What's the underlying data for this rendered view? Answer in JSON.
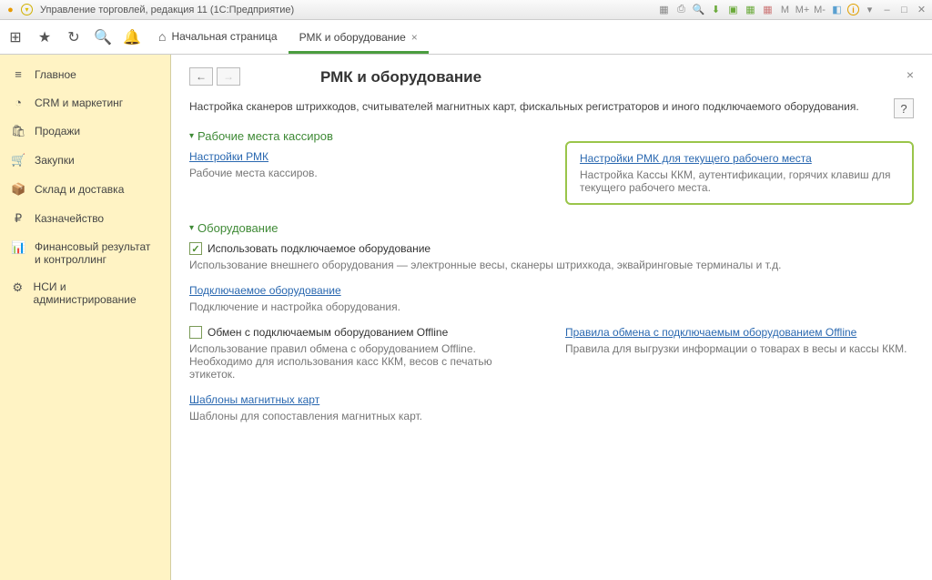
{
  "titlebar": {
    "title": "Управление торговлей, редакция 11  (1С:Предприятие)",
    "m_icons": [
      "M",
      "M+",
      "M-"
    ]
  },
  "tabs": {
    "home": "Начальная страница",
    "active": "РМК и оборудование"
  },
  "sidebar": {
    "items": [
      {
        "icon": "≡",
        "label": "Главное"
      },
      {
        "icon": "◔",
        "label": "CRM и маркетинг"
      },
      {
        "icon": "🛍",
        "label": "Продажи"
      },
      {
        "icon": "🛒",
        "label": "Закупки"
      },
      {
        "icon": "📦",
        "label": "Склад и доставка"
      },
      {
        "icon": "₽",
        "label": "Казначейство"
      },
      {
        "icon": "📊",
        "label": "Финансовый результат и контроллинг"
      },
      {
        "icon": "⚙",
        "label": "НСИ и администрирование"
      }
    ]
  },
  "page": {
    "title": "РМК и оборудование",
    "description": "Настройка сканеров штрихкодов, считывателей магнитных карт, фискальных регистраторов и иного подключаемого оборудования.",
    "help": "?",
    "section1": {
      "title": "Рабочие места кассиров",
      "left_link": "Настройки РМК",
      "left_sub": "Рабочие места кассиров.",
      "right_link": "Настройки РМК для текущего рабочего места",
      "right_sub": "Настройка Кассы ККМ, аутентификации, горячих клавиш для текущего рабочего места."
    },
    "section2": {
      "title": "Оборудование",
      "check1_label": "Использовать подключаемое оборудование",
      "check1_sub": "Использование внешнего оборудования — электронные весы, сканеры штрихкода, эквайринговые терминалы и т.д.",
      "link2": "Подключаемое оборудование",
      "sub2": "Подключение и настройка оборудования.",
      "check2_label": "Обмен с подключаемым оборудованием Offline",
      "check2_sub": "Использование правил обмена с оборудованием Offline. Необходимо для использования касс ККМ, весов с печатью этикеток.",
      "right_link": "Правила обмена с подключаемым оборудованием Offline",
      "right_sub": "Правила для выгрузки информации о товарах в весы и кассы ККМ.",
      "link3": "Шаблоны магнитных карт",
      "sub3": "Шаблоны для сопоставления магнитных карт."
    }
  }
}
